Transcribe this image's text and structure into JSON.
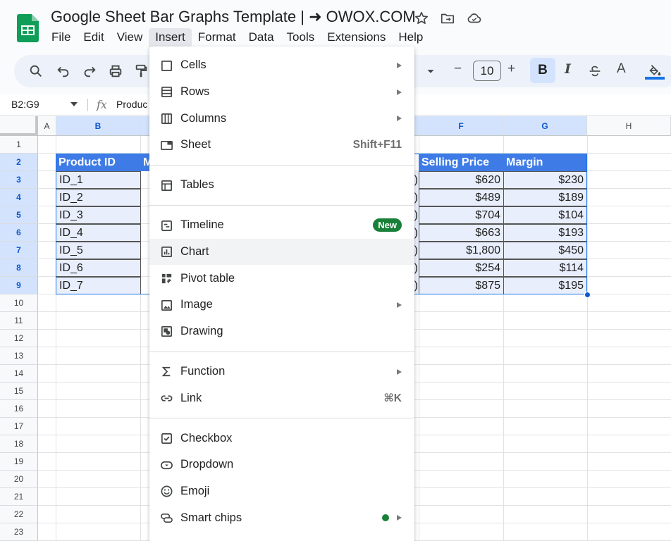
{
  "document": {
    "title": "Google Sheet Bar Graphs Template | ➜ OWOX.COM"
  },
  "menubar": {
    "items": [
      "File",
      "Edit",
      "View",
      "Insert",
      "Format",
      "Data",
      "Tools",
      "Extensions",
      "Help"
    ],
    "active": "Insert"
  },
  "toolbar": {
    "font_size": "10",
    "bold_label": "B",
    "italic_label": "I",
    "text_color_label": "A",
    "decrease_label": "−",
    "increase_label": "+"
  },
  "formula_bar": {
    "name_box": "B2:G9",
    "fx_label": "fx",
    "formula": "Produc"
  },
  "grid": {
    "columns": [
      "A",
      "B",
      "",
      "F",
      "G",
      "H"
    ],
    "selected_columns": [
      "B",
      "F",
      "G"
    ],
    "rows": [
      "1",
      "2",
      "3",
      "4",
      "5",
      "6",
      "7",
      "8",
      "9",
      "10",
      "11",
      "12",
      "13",
      "14",
      "15",
      "16",
      "17",
      "18",
      "19",
      "20",
      "21",
      "22",
      "23"
    ],
    "selected_rows": [
      "2",
      "3",
      "4",
      "5",
      "6",
      "7",
      "8",
      "9"
    ],
    "header_row": {
      "b": "Product ID",
      "c": "M",
      "f": "Selling Price",
      "g": "Margin"
    },
    "data_rows": [
      {
        "b": "ID_1",
        "e": ")",
        "f": "$620",
        "g": "$230"
      },
      {
        "b": "ID_2",
        "e": ")",
        "f": "$489",
        "g": "$189"
      },
      {
        "b": "ID_3",
        "e": ")",
        "f": "$704",
        "g": "$104"
      },
      {
        "b": "ID_4",
        "e": ")",
        "f": "$663",
        "g": "$193"
      },
      {
        "b": "ID_5",
        "e": ")",
        "f": "$1,800",
        "g": "$450"
      },
      {
        "b": "ID_6",
        "e": ")",
        "f": "$254",
        "g": "$114"
      },
      {
        "b": "ID_7",
        "e": ")",
        "f": "$875",
        "g": "$195"
      }
    ]
  },
  "insert_menu": {
    "items": [
      {
        "label": "Cells",
        "icon": "cells-icon",
        "submenu": true
      },
      {
        "label": "Rows",
        "icon": "rows-icon",
        "submenu": true
      },
      {
        "label": "Columns",
        "icon": "columns-icon",
        "submenu": true
      },
      {
        "label": "Sheet",
        "icon": "sheet-icon",
        "shortcut": "Shift+F11"
      },
      {
        "label": "Tables",
        "icon": "tables-icon"
      },
      {
        "label": "Timeline",
        "icon": "timeline-icon",
        "badge": "New"
      },
      {
        "label": "Chart",
        "icon": "chart-icon",
        "highlighted": true
      },
      {
        "label": "Pivot table",
        "icon": "pivot-table-icon"
      },
      {
        "label": "Image",
        "icon": "image-icon",
        "submenu": true
      },
      {
        "label": "Drawing",
        "icon": "drawing-icon"
      },
      {
        "label": "Function",
        "icon": "function-icon",
        "submenu": true
      },
      {
        "label": "Link",
        "icon": "link-icon",
        "shortcut": "⌘K"
      },
      {
        "label": "Checkbox",
        "icon": "checkbox-icon"
      },
      {
        "label": "Dropdown",
        "icon": "dropdown-icon"
      },
      {
        "label": "Emoji",
        "icon": "emoji-icon"
      },
      {
        "label": "Smart chips",
        "icon": "smart-chips-icon",
        "submenu": true,
        "dot": true
      }
    ]
  },
  "colors": {
    "accent": "#1a73e8",
    "header_fill": "#3e7be6",
    "cell_fill": "#e8eefc",
    "badge": "#188038",
    "sheets_green": "#0f9d58"
  }
}
